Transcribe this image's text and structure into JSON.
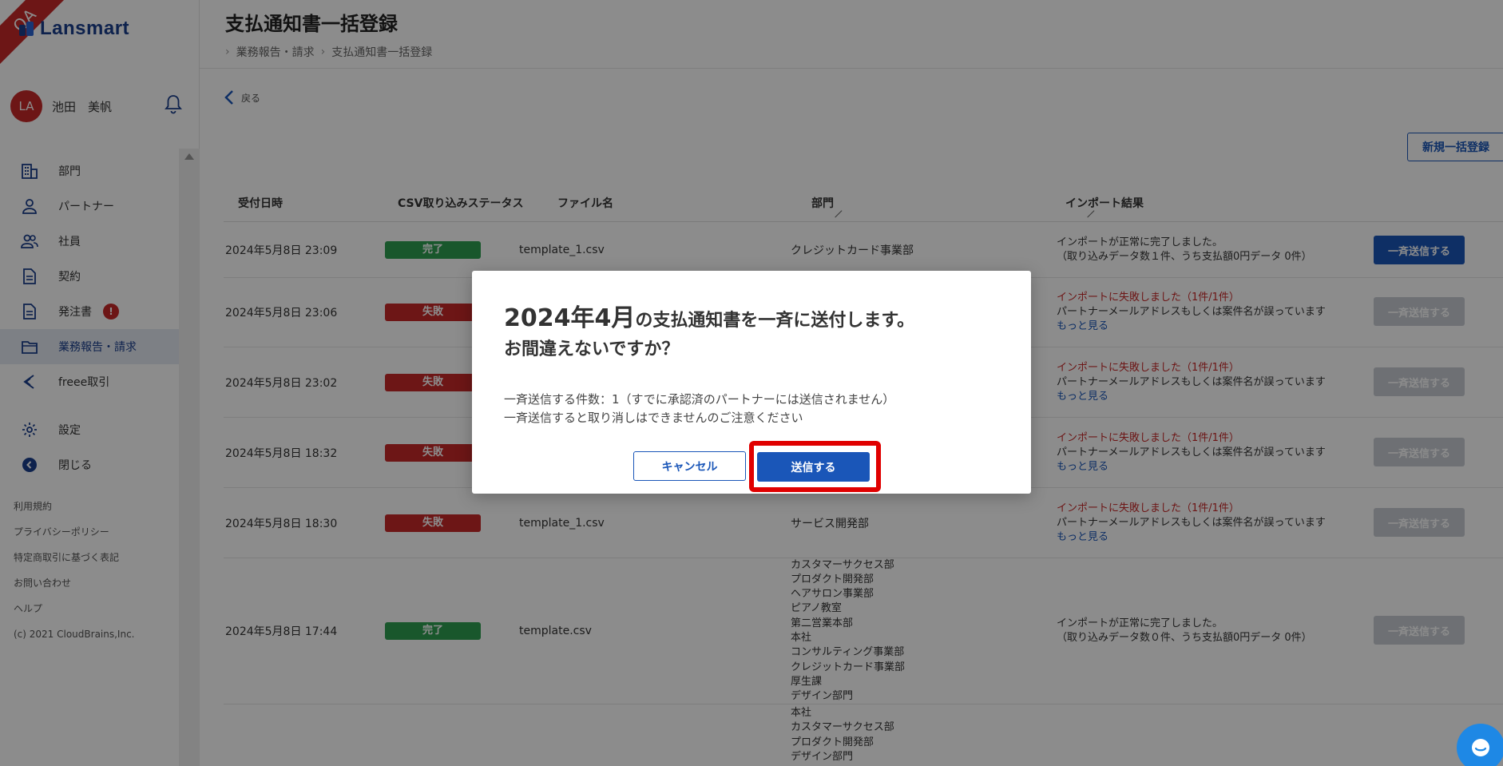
{
  "app": {
    "logo_text": "Lansmart",
    "env_ribbon": "QA"
  },
  "user": {
    "initials": "LA",
    "name": "池田　美帆"
  },
  "sidebar": {
    "items": [
      {
        "label": "部門",
        "icon": "building-icon"
      },
      {
        "label": "パートナー",
        "icon": "person-icon"
      },
      {
        "label": "社員",
        "icon": "people-icon"
      },
      {
        "label": "契約",
        "icon": "document-icon"
      },
      {
        "label": "発注書",
        "icon": "document-icon",
        "badge": "!"
      },
      {
        "label": "業務報告・請求",
        "icon": "folder-icon",
        "active": true
      },
      {
        "label": "freee取引",
        "icon": "freee-icon"
      }
    ],
    "settings_label": "設定",
    "close_label": "閉じる",
    "footer": [
      "利用規約",
      "プライバシーポリシー",
      "特定商取引に基づく表記",
      "お問い合わせ",
      "ヘルプ",
      "(c) 2021 CloudBrains,Inc."
    ]
  },
  "header": {
    "title": "支払通知書一括登録",
    "breadcrumb": [
      "業務報告・請求",
      "支払通知書一括登録"
    ]
  },
  "back_label": "戻る",
  "new_button_label": "新規一括登録",
  "table": {
    "headers": [
      "受付日時",
      "CSV取り込みステータス",
      "ファイル名",
      "部門",
      "インポート結果"
    ],
    "send_label": "一斉送信する",
    "more_label": "もっと見る",
    "rows": [
      {
        "date": "2024年5月8日 23:09",
        "status": "完了",
        "file": "template_1.csv",
        "dept": "クレジットカード事業部",
        "result1": "インポートが正常に完了しました。",
        "result2": "（取り込みデータ数１件、うち支払額0円データ 0件）"
      },
      {
        "date": "2024年5月8日 23:06",
        "status": "失敗",
        "result1": "インポートに失敗しました（1件/1件）",
        "result2": "パートナーメールアドレスもしくは案件名が誤っています"
      },
      {
        "date": "2024年5月8日 23:02",
        "status": "失敗",
        "result1": "インポートに失敗しました（1件/1件）",
        "result2": "パートナーメールアドレスもしくは案件名が誤っています"
      },
      {
        "date": "2024年5月8日 18:32",
        "status": "失敗",
        "result1": "インポートに失敗しました（1件/1件）",
        "result2": "パートナーメールアドレスもしくは案件名が誤っています"
      },
      {
        "date": "2024年5月8日 18:30",
        "status": "失敗",
        "file": "template_1.csv",
        "dept": "サービス開発部",
        "result1": "インポートに失敗しました（1件/1件）",
        "result2": "パートナーメールアドレスもしくは案件名が誤っています"
      },
      {
        "date": "2024年5月8日 17:44",
        "status": "完了",
        "file": "template.csv",
        "depts": [
          "カスタマーサクセス部",
          "プロダクト開発部",
          "ヘアサロン事業部",
          "ピアノ教室",
          "第二営業本部",
          "本社",
          "コンサルティング事業部",
          "クレジットカード事業部",
          "厚生課",
          "デザイン部門"
        ],
        "result1": "インポートが正常に完了しました。",
        "result2": "（取り込みデータ数０件、うち支払額0円データ 0件）"
      },
      {
        "depts": [
          "本社",
          "カスタマーサクセス部",
          "プロダクト開発部",
          "デザイン部門"
        ]
      }
    ]
  },
  "dialog": {
    "title_big": "2024年4月",
    "title_rest": "の支払通知書を一斉に送付します。",
    "title_line2": "お間違えないですか？",
    "body_line1": "一斉送信する件数：1（すでに承認済のパートナーには送信されません）",
    "body_line2": "一斉送信すると取り消しはできませんのご注意ください",
    "cancel_label": "キャンセル",
    "send_label": "送信する"
  },
  "colors": {
    "brand": "#1a56b8",
    "success": "#2e9e50",
    "danger": "#c62828",
    "highlight": "#e00000"
  }
}
